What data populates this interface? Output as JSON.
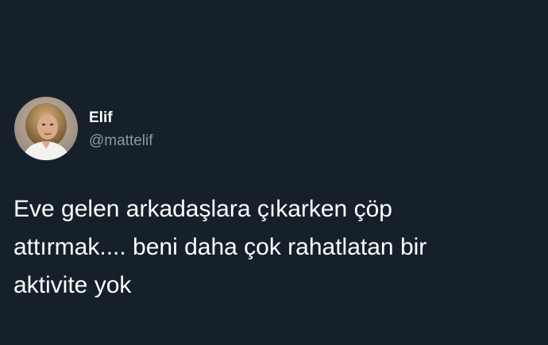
{
  "colors": {
    "background": "#15202b",
    "name": "#ffffff",
    "handle": "#8899a6",
    "text": "#ffffff"
  },
  "user": {
    "display_name": "Elif",
    "handle": "@mattelif",
    "avatar_icon": "profile-photo"
  },
  "tweet": {
    "text": "Eve gelen arkadaşlara çıkarken çöp\nattırmak.... beni daha çok rahatlatan bir\naktivite yok"
  }
}
